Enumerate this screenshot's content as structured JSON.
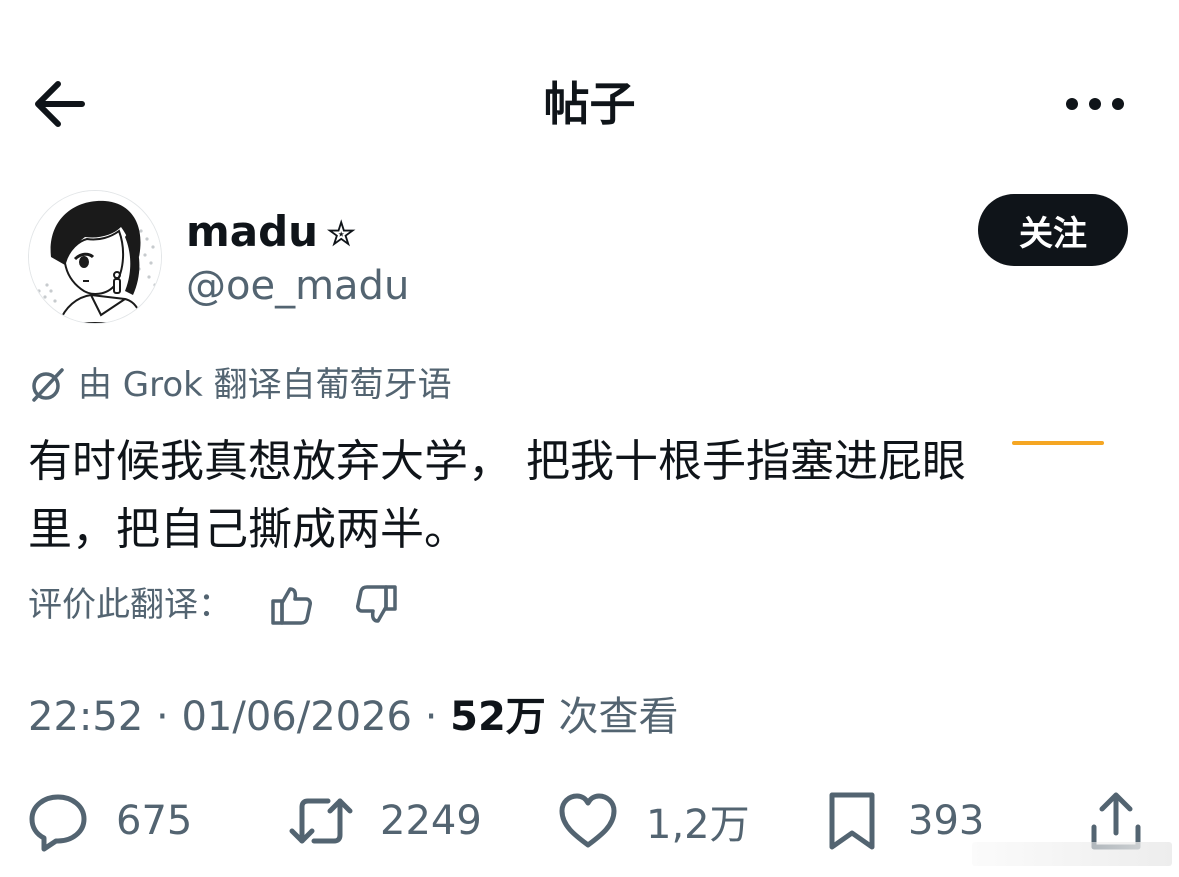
{
  "header": {
    "title": "帖子"
  },
  "author": {
    "display_name": "madu",
    "name_badge": "✮",
    "handle": "@oe_madu",
    "follow_label": "关注"
  },
  "post": {
    "translation_notice": "由 Grok 翻译自葡萄牙语",
    "text": "有时候我真想放弃大学， 把我十根手指塞进屁眼\n里，把自己撕成两半。",
    "rate_label": "评价此翻译："
  },
  "meta": {
    "time": "22:52",
    "date": "01/06/2026",
    "separator": "·",
    "views_count": "52万",
    "views_label": "次查看"
  },
  "stats": {
    "replies": "675",
    "reposts": "2249",
    "likes": "1,2万",
    "bookmarks": "393"
  },
  "colors": {
    "text_primary": "#0f1419",
    "text_secondary": "#536471",
    "follow_bg": "#0f1419",
    "highlight_underline": "#f5a623"
  },
  "icons": [
    "back-arrow-icon",
    "more-icon",
    "grok-icon",
    "thumbs-up-icon",
    "thumbs-down-icon",
    "reply-icon",
    "repost-icon",
    "like-icon",
    "bookmark-icon",
    "share-icon"
  ]
}
